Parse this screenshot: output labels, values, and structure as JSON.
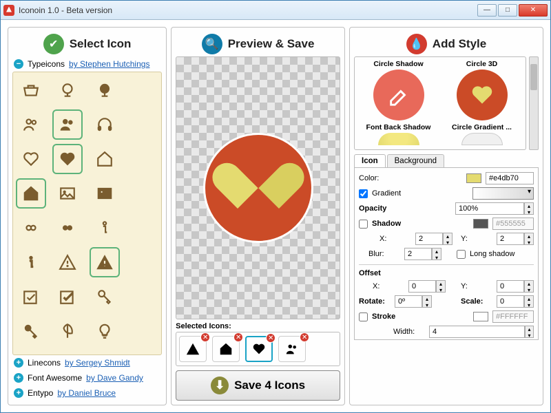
{
  "window": {
    "title": "Iconoin 1.0 - Beta version"
  },
  "headers": {
    "select": "Select Icon",
    "preview": "Preview & Save",
    "style": "Add Style"
  },
  "packs": {
    "open": {
      "name": "Typeicons",
      "author": "by Stephen Hutchings"
    },
    "closed": [
      {
        "name": "Linecons",
        "author": "by Sergey Shmidt"
      },
      {
        "name": "Font Awesome",
        "author": "by Dave Gandy"
      },
      {
        "name": "Entypo",
        "author": "by Daniel Bruce"
      }
    ]
  },
  "selected_label": "Selected Icons:",
  "save_label": "Save 4 Icons",
  "styles": [
    {
      "name": "Circle Shadow"
    },
    {
      "name": "Circle 3D"
    },
    {
      "name": "Font Back Shadow"
    },
    {
      "name": "Circle Gradient ..."
    }
  ],
  "tabs": {
    "icon": "Icon",
    "background": "Background"
  },
  "props": {
    "color_label": "Color:",
    "color_value": "#e4db70",
    "gradient_label": "Gradient",
    "gradient_checked": true,
    "opacity_label": "Opacity",
    "opacity_value": "100%",
    "shadow_label": "Shadow",
    "shadow_checked": false,
    "shadow_color": "#555555",
    "shadow_x_label": "X:",
    "shadow_x": "2",
    "shadow_y_label": "Y:",
    "shadow_y": "2",
    "blur_label": "Blur:",
    "blur": "2",
    "longshadow_label": "Long shadow",
    "offset_label": "Offset",
    "offset_x_label": "X:",
    "offset_x": "0",
    "offset_y_label": "Y:",
    "offset_y": "0",
    "rotate_label": "Rotate:",
    "rotate": "0º",
    "scale_label": "Scale:",
    "scale": "0",
    "stroke_label": "Stroke",
    "stroke_color": "#FFFFFF",
    "width_label": "Width:",
    "width": "4"
  }
}
